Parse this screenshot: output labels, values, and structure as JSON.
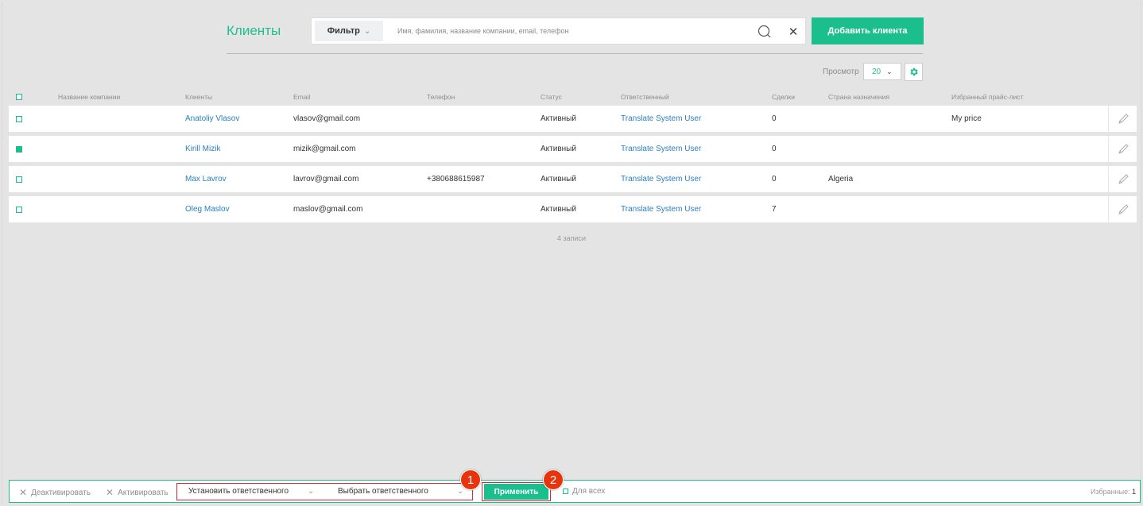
{
  "header": {
    "title": "Клиенты",
    "filter_label": "Фильтр",
    "search_placeholder": "Имя, фамилия, название компании, email, телефон",
    "search_value": "",
    "add_button": "Добавить клиента"
  },
  "view": {
    "label": "Просмотр",
    "page_size": "20"
  },
  "table": {
    "columns": {
      "company": "Название компании",
      "client": "Клиенты",
      "email": "Email",
      "phone": "Телефон",
      "status": "Статус",
      "owner": "Ответственный",
      "deals": "Сделки",
      "country": "Страна назначения",
      "pricelist": "Избранный прайс-лист"
    },
    "rows": [
      {
        "checked": false,
        "company": "",
        "client": "Anatoliy Vlasov",
        "email": "vlasov@gmail.com",
        "phone": "",
        "status": "Активный",
        "owner": "Translate System User",
        "deals": "0",
        "country": "",
        "pricelist": "My price"
      },
      {
        "checked": true,
        "company": "",
        "client": "Kirill Mizik",
        "email": "mizik@gmail.com",
        "phone": "",
        "status": "Активный",
        "owner": "Translate System User",
        "deals": "0",
        "country": "",
        "pricelist": ""
      },
      {
        "checked": false,
        "company": "",
        "client": "Max Lavrov",
        "email": "lavrov@gmail.com",
        "phone": "+380688615987",
        "status": "Активный",
        "owner": "Translate System User",
        "deals": "0",
        "country": "Algeria",
        "pricelist": ""
      },
      {
        "checked": false,
        "company": "",
        "client": "Oleg Maslov",
        "email": "maslov@gmail.com",
        "phone": "",
        "status": "Активный",
        "owner": "Translate System User",
        "deals": "7",
        "country": "",
        "pricelist": ""
      }
    ],
    "records": "4 записи"
  },
  "bottom_bar": {
    "deactivate": "Деактивировать",
    "activate": "Активировать",
    "action_select": "Установить ответственного",
    "owner_select": "Выбрать ответственного",
    "apply": "Применить",
    "for_all": "Для всех",
    "favorites_label": "Избранные:",
    "favorites_count": "1"
  },
  "badges": [
    "1",
    "2"
  ],
  "colors": {
    "accent": "#1bbf8e",
    "link": "#2a7fc4",
    "highlight": "#d9282f",
    "badge": "#e8340c"
  }
}
